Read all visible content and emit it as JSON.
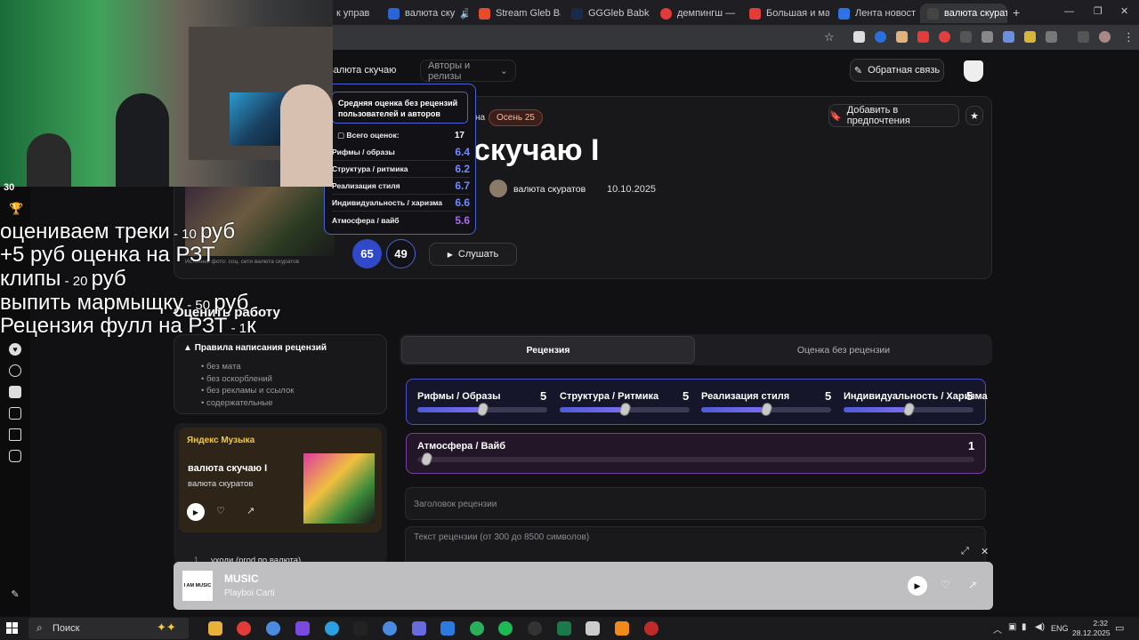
{
  "browser": {
    "tabs": [
      {
        "label": "к управ",
        "color": "#1f6feb"
      },
      {
        "label": "валюта ску",
        "color": "#2b63d9"
      },
      {
        "label": "Stream Gleb Ba",
        "color": "#e34b2a"
      },
      {
        "label": "GGGleb Babki",
        "color": "#1b2a4a"
      },
      {
        "label": "демпингш —",
        "color": "#e33a3a"
      },
      {
        "label": "Большая и ма",
        "color": "#e33a3a"
      },
      {
        "label": "Лента новост",
        "color": "#2b73e6"
      },
      {
        "label": "валюта скурат",
        "color": "#444"
      }
    ],
    "new_tab": "+"
  },
  "nav": {
    "breadcrumb": "валюта скучаю",
    "dropdown_label": "Авторы и релизы",
    "feedback_label": "Обратная связь"
  },
  "release": {
    "badge_partial": "на",
    "season_badge": "Осень 25",
    "title_fragment": "скучаю I",
    "artist_name": "валюта скуратов",
    "release_date": "10.10.2025",
    "cover_source": "Источник фото: соц. сети валюта скуратов",
    "score_main": "65",
    "score_no_review": "49",
    "listen_label": "Слушать",
    "add_pref_label": "Добавить в предпочтения"
  },
  "tooltip": {
    "title": "Средняя оценка без рецензий пользователей и авторов",
    "total_label": "Всего оценок:",
    "total_value": "17",
    "rows": [
      {
        "label": "Рифмы / образы",
        "value": "6.4"
      },
      {
        "label": "Структура / ритмика",
        "value": "6.2"
      },
      {
        "label": "Реализация стиля",
        "value": "6.7"
      },
      {
        "label": "Индивидуальность / харизма",
        "value": "6.6"
      },
      {
        "label": "Атмосфера / вайб",
        "value": "5.6"
      }
    ]
  },
  "rate_section": {
    "heading": "Оценить работу",
    "rules_title": "Правила написания рецензий",
    "rules": [
      "без мата",
      "без оскорблений",
      "без рекламы и ссылок",
      "содержательные"
    ],
    "tab_review": "Рецензия",
    "tab_no_review": "Оценка без рецензии",
    "criteria": [
      {
        "label": "Рифмы / Образы",
        "value": "5",
        "level": 0.5
      },
      {
        "label": "Структура / Ритмика",
        "value": "5",
        "level": 0.5
      },
      {
        "label": "Реализация стиля",
        "value": "5",
        "level": 0.5
      },
      {
        "label": "Индивидуальность / Харизма",
        "value": "5",
        "level": 0.5
      }
    ],
    "vibe": {
      "label": "Атмосфера / Вайб",
      "value": "1",
      "level": 0.0
    },
    "review_title_placeholder": "Заголовок рецензии",
    "review_text_placeholder": "Текст рецензии (от 300 до 8500 символов)"
  },
  "yandex_widget": {
    "brand": "Яндекс Музыка",
    "track": "валюта скучаю I",
    "artist": "валюта скуратов",
    "next_track": "уходи (prod.по валюта)",
    "track_num": "1"
  },
  "player": {
    "title": "MUSIC",
    "artist": "Playboi Carti",
    "cover_text": "I AM MUSIC"
  },
  "overlay": {
    "lines": [
      {
        "text": "оцениваем треки",
        "small": " - 10 ",
        "tail": "руб"
      },
      {
        "text": "+5 руб оценка на РЗТ",
        "small": "",
        "tail": ""
      },
      {
        "text": "клипы",
        "small": " - 20 ",
        "tail": "руб"
      },
      {
        "text": "выпить мармыщку",
        "small": " - 50 ",
        "tail": "руб"
      },
      {
        "text": "Рецензия фулл на РЗТ",
        "small": " - 1",
        "tail": "к"
      }
    ],
    "side_number": "30"
  },
  "taskbar": {
    "search_label": "Поиск",
    "lang": "ENG",
    "time": "2:32",
    "date": "28.12.2025"
  }
}
